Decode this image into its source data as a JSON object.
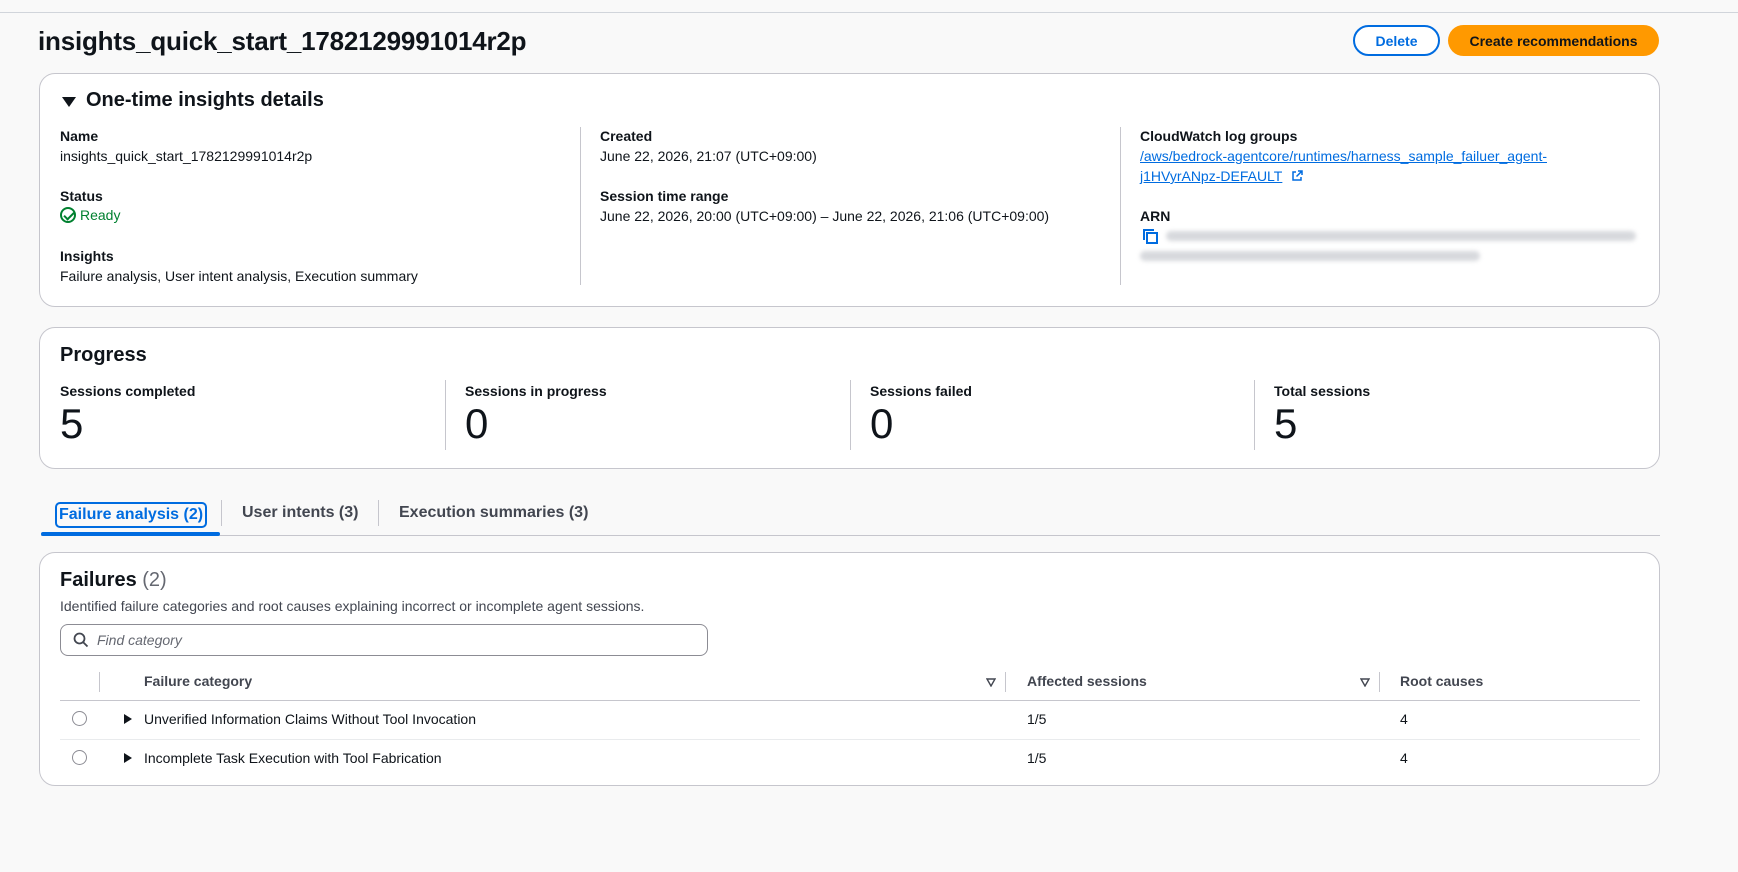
{
  "page": {
    "title": "insights_quick_start_1782129991014r2p",
    "delete_label": "Delete",
    "create_label": "Create recommendations"
  },
  "details": {
    "heading": "One-time insights details",
    "name_label": "Name",
    "name_value": "insights_quick_start_1782129991014r2p",
    "status_label": "Status",
    "status_value": "Ready",
    "insights_label": "Insights",
    "insights_value": "Failure analysis, User intent analysis, Execution summary",
    "created_label": "Created",
    "created_value": "June 22, 2026, 21:07 (UTC+09:00)",
    "range_label": "Session time range",
    "range_value": "June 22, 2026, 20:00 (UTC+09:00) – June 22, 2026, 21:06 (UTC+09:00)",
    "log_groups_label": "CloudWatch log groups",
    "log_group_line1": "/aws/bedrock-agentcore/runtimes/harness_sample_failuer_agent-",
    "log_group_line2": "j1HVyrANpz-DEFAULT",
    "arn_label": "ARN"
  },
  "progress": {
    "heading": "Progress",
    "stats": [
      {
        "label": "Sessions completed",
        "value": "5"
      },
      {
        "label": "Sessions in progress",
        "value": "0"
      },
      {
        "label": "Sessions failed",
        "value": "0"
      },
      {
        "label": "Total sessions",
        "value": "5"
      }
    ]
  },
  "tabs": [
    {
      "label": "Failure analysis (2)",
      "active": true
    },
    {
      "label": "User intents (3)",
      "active": false
    },
    {
      "label": "Execution summaries (3)",
      "active": false
    }
  ],
  "failures": {
    "heading": "Failures",
    "count": "(2)",
    "description": "Identified failure categories and root causes explaining incorrect or incomplete agent sessions.",
    "search_placeholder": "Find category",
    "columns": [
      "Failure category",
      "Affected sessions",
      "Root causes"
    ],
    "rows": [
      {
        "category": "Unverified Information Claims Without Tool Invocation",
        "affected": "1/5",
        "root_causes": "4"
      },
      {
        "category": "Incomplete Task Execution with Tool Fabrication",
        "affected": "1/5",
        "root_causes": "4"
      }
    ]
  },
  "colors": {
    "primary": "#006ce0",
    "accent": "#ff9900",
    "success": "#00802f"
  }
}
